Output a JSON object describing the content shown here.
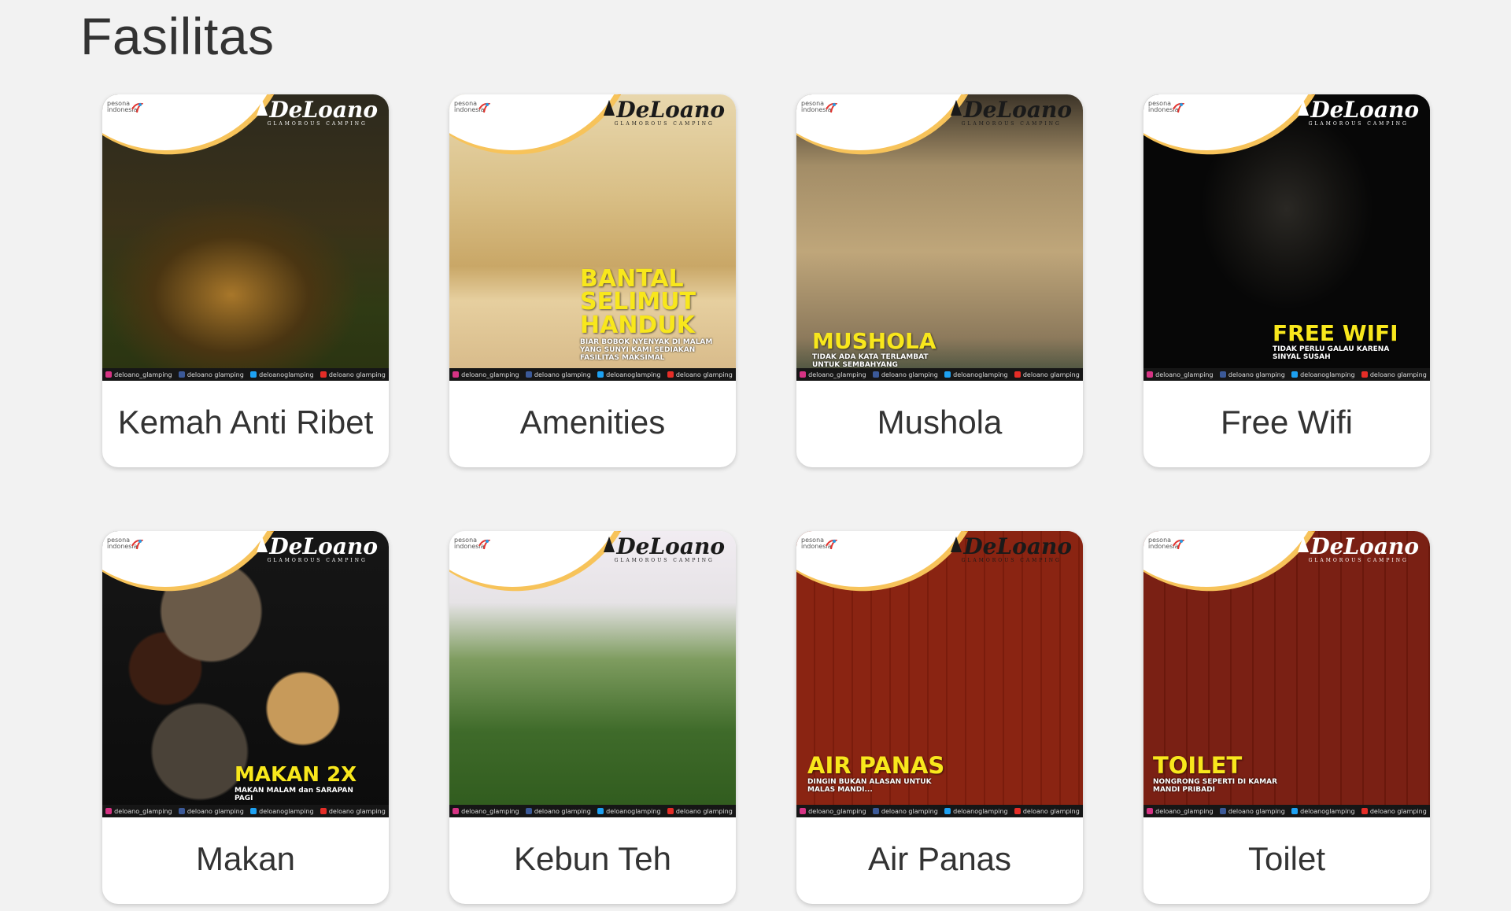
{
  "section": {
    "title": "Fasilitas"
  },
  "brand": {
    "name": "DeLoano",
    "tagline": "GLAMOROUS CAMPING",
    "pesona_top": "pesona",
    "pesona_bottom": "indonesia"
  },
  "social": {
    "instagram": "deloano_glamping",
    "facebook": "deloano glamping",
    "twitter": "deloanoglamping",
    "youtube": "deloano glamping"
  },
  "cards": [
    {
      "label": "Kemah Anti Ribet",
      "overlay_title": "",
      "overlay_sub": ""
    },
    {
      "label": "Amenities",
      "overlay_title": "BANTAL\nSELIMUT\nHANDUK",
      "overlay_sub": "BIAR BOBOK NYENYAK DI MALAM YANG SUNYI KAMI SEDIAKAN FASILITAS MAKSIMAL"
    },
    {
      "label": "Mushola",
      "overlay_title": "MUSHOLA",
      "overlay_sub": "TIDAK ADA KATA TERLAMBAT UNTUK SEMBAHYANG"
    },
    {
      "label": "Free Wifi",
      "overlay_title": "FREE WIFI",
      "overlay_sub": "TIDAK PERLU GALAU KARENA SINYAL SUSAH"
    },
    {
      "label": "Makan",
      "overlay_title": "MAKAN 2X",
      "overlay_sub": "MAKAN MALAM dan SARAPAN PAGI"
    },
    {
      "label": "Kebun Teh",
      "overlay_title": "",
      "overlay_sub": ""
    },
    {
      "label": "Air Panas",
      "overlay_title": "AIR PANAS",
      "overlay_sub": "DINGIN BUKAN ALASAN UNTUK MALAS MANDI..."
    },
    {
      "label": "Toilet",
      "overlay_title": "TOILET",
      "overlay_sub": "NONGRONG SEPERTI DI KAMAR MANDI PRIBADI"
    }
  ],
  "colors": {
    "background": "#f2f2f2",
    "overlay_text": "#f8e71c",
    "swoosh": "#f4a21a"
  }
}
